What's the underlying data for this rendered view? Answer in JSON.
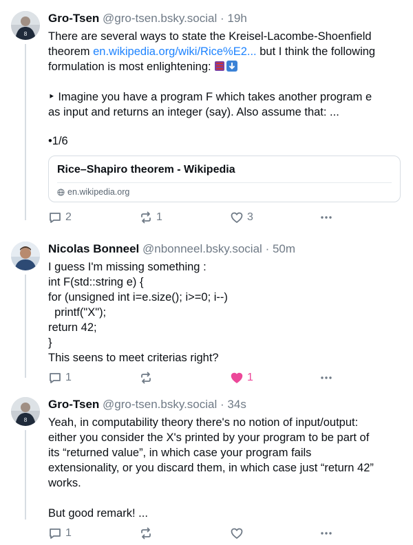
{
  "posts": [
    {
      "author": "Gro-Tsen",
      "handle": "@gro-tsen.bsky.social",
      "separator": "·",
      "time": "19h",
      "text_line1": "There are several ways to state the Kreisel-Lacombe-Shoenfield",
      "text_line2_pre": "theorem ",
      "text_line2_link": "en.wikipedia.org/wiki/Rice%E2...",
      "text_line2_post": " but I think the following",
      "text_line3": "formulation is most enlightening: ",
      "text_line4": "‣ Imagine you have a program F which takes another program e",
      "text_line5": "as input and returns an integer (say). Also assume that: ...",
      "text_line6": "•1/6",
      "card_title": "Rice–Shapiro theorem - Wikipedia",
      "card_domain": "en.wikipedia.org",
      "replies": "2",
      "reposts": "1",
      "likes": "3"
    },
    {
      "author": "Nicolas Bonneel",
      "handle": "@nbonneel.bsky.social",
      "separator": "·",
      "time": "50m",
      "lines": [
        "I guess I'm missing something :",
        "int F(std::string e) {",
        "for (unsigned int i=e.size(); i>=0; i--)",
        "  printf(\"X\");",
        "return 42;",
        "}",
        "This seens to meet criterias right?"
      ],
      "replies": "1",
      "reposts": "",
      "likes": "1"
    },
    {
      "author": "Gro-Tsen",
      "handle": "@gro-tsen.bsky.social",
      "separator": "·",
      "time": "34s",
      "lines": [
        "Yeah, in computability theory there's no notion of input/output:",
        "either you consider the X's printed by your program to be part of",
        "its “returned value”, in which case your program fails",
        "extensionality, or you discard them, in which case just “return 42”",
        "works."
      ],
      "line_last": "But good remark! ...",
      "replies": "1",
      "reposts": "",
      "likes": ""
    }
  ],
  "icons": {
    "reply": "reply-icon",
    "repost": "repost-icon",
    "like": "heart-icon",
    "more": "more-icon",
    "globe": "globe-icon"
  },
  "colors": {
    "link": "#1d83ff",
    "liked": "#ec4899",
    "muted": "#6f7a86"
  }
}
